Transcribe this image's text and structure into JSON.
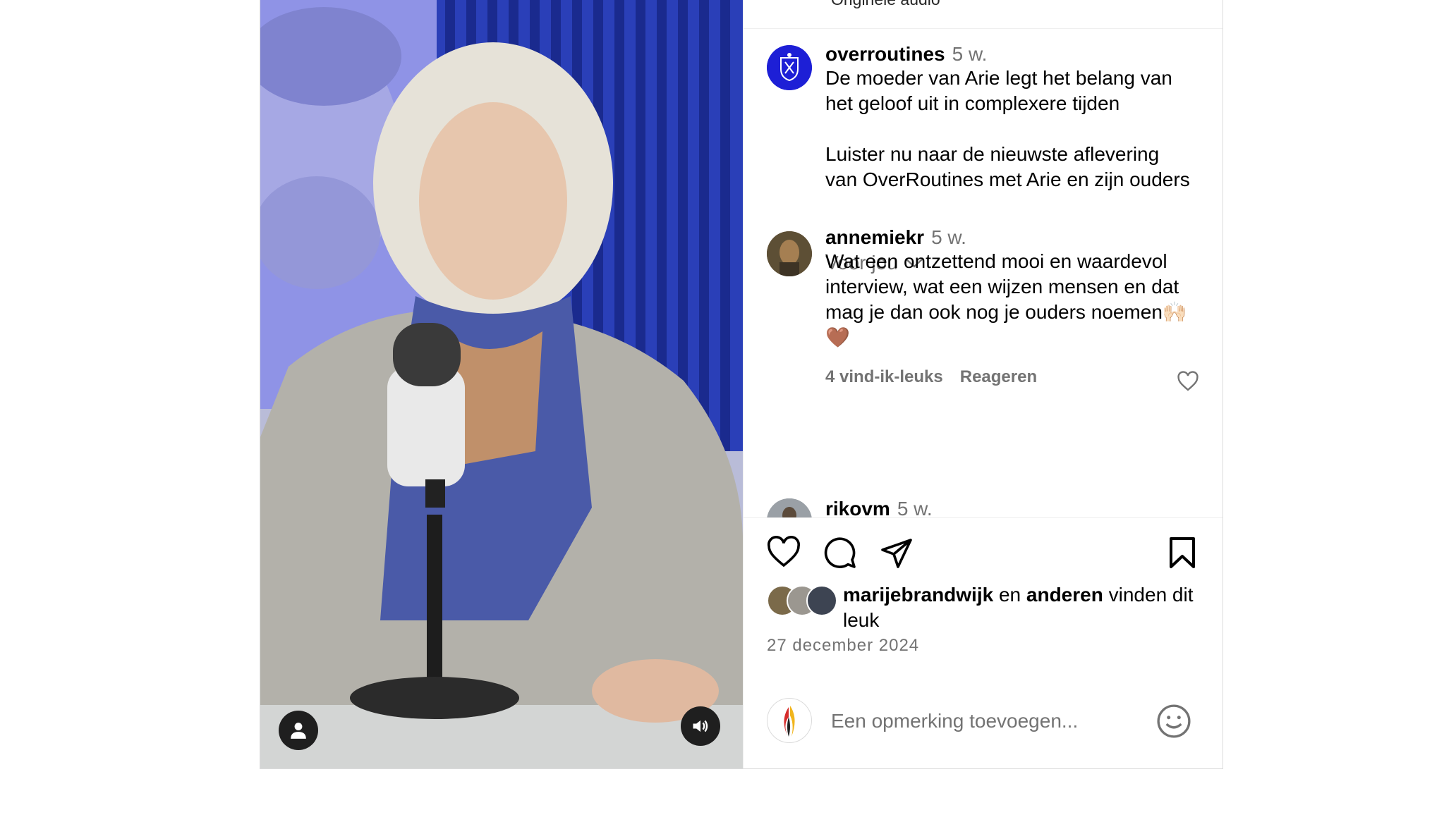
{
  "post": {
    "audio_label": "Originele audio"
  },
  "caption": {
    "username": "overroutines",
    "age": "5 w.",
    "text": "De moeder van Arie legt het belang van het geloof uit in complexere tijden\n\nLuister nu naar de nieuwste aflevering van OverRoutines met Arie en zijn ouders",
    "for_you_label": "Voor jou"
  },
  "comments": [
    {
      "username": "annemiekr",
      "age": "5 w.",
      "text": "Wat een ontzettend mooi en waardevol interview, wat een wijzen mensen en dat mag je dan ook nog je ouders noemen🙌🏻🤎",
      "likes_label": "4 vind-ik-leuks",
      "reply_label": "Reageren"
    },
    {
      "username": "rikovm",
      "age": "5 w."
    }
  ],
  "likes": {
    "first_user": "marijebrandwijk",
    "connector": "en",
    "others": "anderen",
    "suffix": "vinden dit leuk"
  },
  "date": "27 december 2024",
  "composer": {
    "placeholder": "Een opmerking toevoegen..."
  },
  "icons": {
    "like": "heart-icon",
    "comment": "comment-icon",
    "share": "send-icon",
    "save": "bookmark-icon",
    "emoji": "smiley-icon",
    "mute": "speaker-icon",
    "tags": "user-icon"
  },
  "colors": {
    "brand_avatar": "#1d1fd6",
    "secondary_text": "#737373",
    "divider": "#efefef"
  }
}
